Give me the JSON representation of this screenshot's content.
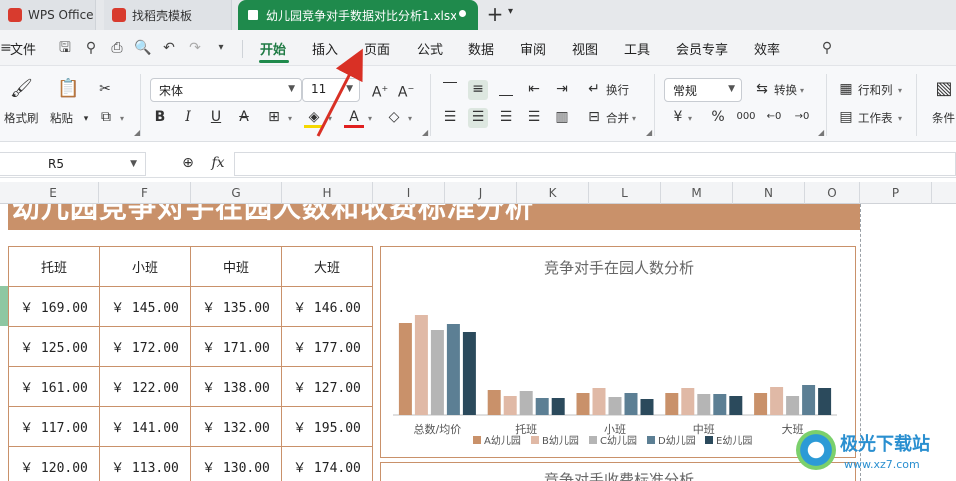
{
  "tabs": [
    {
      "label": "WPS Office"
    },
    {
      "label": "找稻壳模板"
    },
    {
      "label": "幼儿园竞争对手数据对比分析1.xlsx"
    }
  ],
  "menu": {
    "file": "文件",
    "items": [
      "开始",
      "插入",
      "页面",
      "公式",
      "数据",
      "审阅",
      "视图",
      "工具",
      "会员专享",
      "效率"
    ]
  },
  "ribbon": {
    "format_painter": "格式刷",
    "paste": "粘贴",
    "font_name": "宋体",
    "font_size": "11",
    "wrap": "换行",
    "merge": "合并",
    "number_format": "常规",
    "convert": "转换",
    "rows_cols": "行和列",
    "worksheet": "工作表",
    "conditional": "条件",
    "currency": "¥",
    "percent": "%",
    "thousands": "000"
  },
  "formula_bar": {
    "cell_ref": "R5",
    "fx": "fx"
  },
  "columns": [
    "E",
    "F",
    "G",
    "H",
    "I",
    "J",
    "K",
    "L",
    "M",
    "N",
    "O",
    "P"
  ],
  "sheet": {
    "banner_title": "幼儿园竞争对手在园人数和收费标准分析",
    "headers": [
      "托班",
      "小班",
      "中班",
      "大班"
    ],
    "rows": [
      [
        "￥ 169.00",
        "￥ 145.00",
        "￥ 135.00",
        "￥ 146.00"
      ],
      [
        "￥ 125.00",
        "￥ 172.00",
        "￥ 171.00",
        "￥ 177.00"
      ],
      [
        "￥ 161.00",
        "￥ 122.00",
        "￥ 138.00",
        "￥ 127.00"
      ],
      [
        "￥ 117.00",
        "￥ 141.00",
        "￥ 132.00",
        "￥ 195.00"
      ],
      [
        "￥ 120.00",
        "￥ 113.00",
        "￥ 130.00",
        "￥ 174.00"
      ]
    ]
  },
  "chart_data": {
    "type": "bar",
    "title": "竞争对手在园人数分析",
    "categories": [
      "总数/均价",
      "托班",
      "小班",
      "中班",
      "大班"
    ],
    "series": [
      {
        "name": "A幼儿园",
        "color": "#c9916a",
        "values": [
          92,
          25,
          22,
          22,
          22
        ]
      },
      {
        "name": "B幼儿园",
        "color": "#e0b9a6",
        "values": [
          100,
          19,
          27,
          27,
          28
        ]
      },
      {
        "name": "C幼儿园",
        "color": "#b5b5b5",
        "values": [
          85,
          24,
          18,
          21,
          19
        ]
      },
      {
        "name": "D幼儿园",
        "color": "#5c7f94",
        "values": [
          91,
          17,
          22,
          21,
          30
        ]
      },
      {
        "name": "E幼儿园",
        "color": "#2b4a5c",
        "values": [
          83,
          17,
          16,
          19,
          27
        ]
      }
    ],
    "ylim": [
      0,
      100
    ],
    "grid": false,
    "legend": "bottom"
  },
  "chart2": {
    "title": "竞争对手收费标准分析"
  },
  "watermark": {
    "text": "极光下载站",
    "url": "www.xz7.com"
  }
}
